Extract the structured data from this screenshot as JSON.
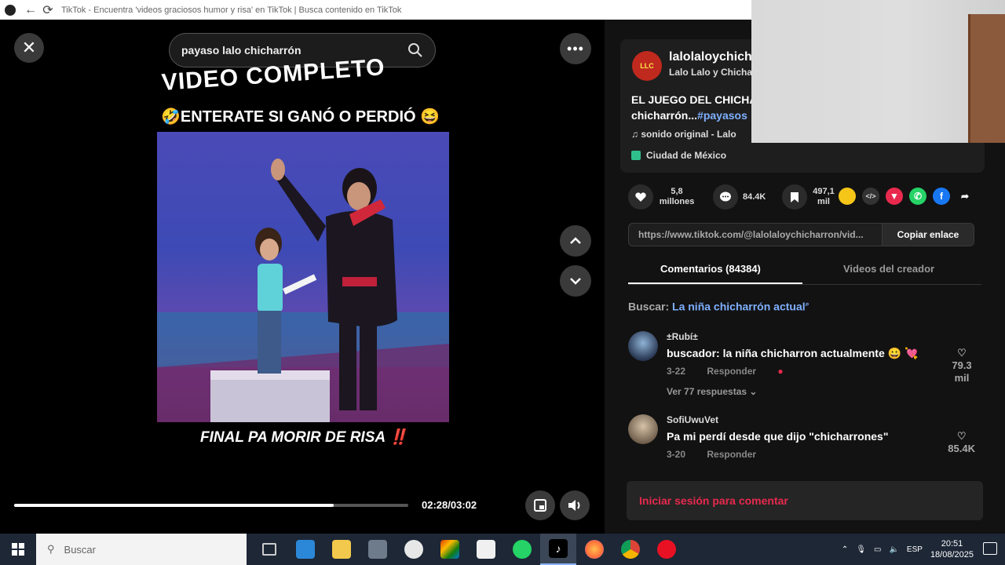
{
  "window": {
    "title": "TikTok - Encuentra 'videos graciosos humor y risa' en TikTok | Busca contenido en TikTok"
  },
  "video": {
    "search_text": "payaso lalo chicharrón",
    "overlay_top": "VIDEO COMPLETO",
    "overlay_mid": "🤣ENTERATE SI GANÓ O PERDIÓ 😆",
    "overlay_bottom": "FINAL PA MORIR DE RISA",
    "overlay_bottom_mark": "‼️",
    "progress_fraction": 0.81,
    "time": "02:28/03:02"
  },
  "author": {
    "username": "lalolaloychicharron",
    "nickname": "Lalo Lalo y Chicharrón",
    "desc_line1": "EL JUEGO DEL CHICHARRÓN",
    "desc_line2": "chicharrón...",
    "desc_tag": "#payasos",
    "music": "sonido original - Lalo",
    "location": "Ciudad de México"
  },
  "actions": {
    "likes": "5,8 millones",
    "comments": "84.4K",
    "saves": "497,1 mil"
  },
  "link": {
    "url": "https://www.tiktok.com/@lalolaloychicharron/vid...",
    "copy_label": "Copiar enlace"
  },
  "tabs": {
    "comments": "Comentarios (84384)",
    "creator_videos": "Videos del creador"
  },
  "search_suggest": {
    "label": "Buscar:",
    "query": "La niña chicharrón actual"
  },
  "comments": [
    {
      "name": "±Rubí±",
      "text": "buscador: la niña chicharron actualmente 😀 💘",
      "date": "3-22",
      "reply": "Responder",
      "likes": "79.3 mil",
      "replies": "Ver 77 respuestas"
    },
    {
      "name": "SofiUwuVet",
      "text": "Pa mi perdí desde que dijo \"chicharrones\"",
      "date": "3-20",
      "reply": "Responder",
      "likes": "85.4K"
    }
  ],
  "login": {
    "label": "Iniciar sesión para comentar"
  },
  "taskbar": {
    "search_placeholder": "Buscar",
    "lang": "ESP",
    "time": "20:51",
    "date": "18/08/2025"
  },
  "colors": {
    "accent_red": "#e8294d",
    "link_blue": "#7fb0ff"
  }
}
